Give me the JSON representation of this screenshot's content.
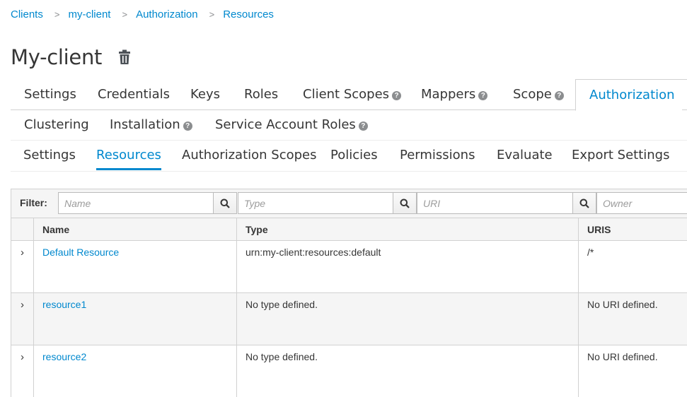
{
  "breadcrumb": {
    "items": [
      "Clients",
      "my-client",
      "Authorization",
      "Resources"
    ],
    "separator": ">"
  },
  "page_title": "My-client",
  "main_tabs": {
    "row1": [
      "Settings",
      "Credentials",
      "Keys",
      "Roles",
      "Client Scopes",
      "Mappers",
      "Scope",
      "Authorization"
    ],
    "row2": [
      "Clustering",
      "Installation",
      "Service Account Roles"
    ],
    "active": "Authorization",
    "help_glyph": "?"
  },
  "sub_tabs": {
    "items": [
      "Settings",
      "Resources",
      "Authorization Scopes",
      "Policies",
      "Permissions",
      "Evaluate",
      "Export Settings"
    ],
    "active": "Resources"
  },
  "filter": {
    "label": "Filter:",
    "placeholders": [
      "Name",
      "Type",
      "URI",
      "Owner"
    ]
  },
  "table": {
    "headers": [
      "Name",
      "Type",
      "URIS"
    ],
    "rows": [
      {
        "name": "Default Resource",
        "type": "urn:my-client:resources:default",
        "uris": "/*"
      },
      {
        "name": "resource1",
        "type": "No type defined.",
        "uris": "No URI defined."
      },
      {
        "name": "resource2",
        "type": "No type defined.",
        "uris": "No URI defined."
      }
    ],
    "expand_glyph": "›"
  },
  "colors": {
    "link": "#0088ce",
    "text": "#363636",
    "border": "#d1d1d1",
    "stripe": "#f5f5f5"
  }
}
